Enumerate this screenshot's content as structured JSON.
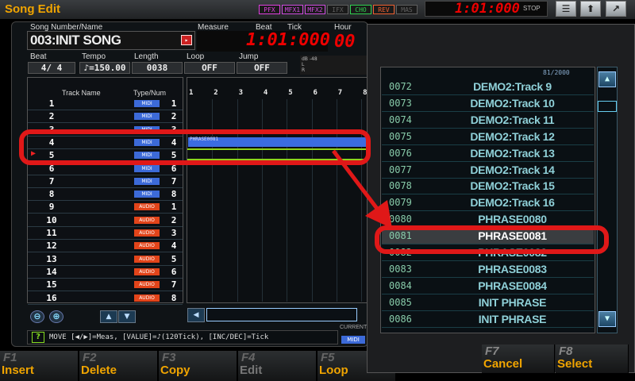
{
  "window": {
    "title": "Song Edit"
  },
  "fx": [
    {
      "label": "PFX",
      "color": "#e040e0"
    },
    {
      "label": "MFX1",
      "color": "#d04ce0"
    },
    {
      "label": "MFX2",
      "color": "#d04ce0"
    },
    {
      "label": "IFX",
      "color": "#606060"
    },
    {
      "label": "CHO",
      "color": "#30d050"
    },
    {
      "label": "REV",
      "color": "#f06030"
    },
    {
      "label": "MAS",
      "color": "#606060"
    }
  ],
  "transport": {
    "time": "1:01:000",
    "status": "STOP"
  },
  "header": {
    "song_label": "Song Number/Name",
    "song_name": "003:INIT SONG",
    "measure_label": "Measure",
    "beat_label": "Beat",
    "tick_label": "Tick",
    "hour_label": "Hour",
    "min_label": "Min",
    "sec_label": "Sec",
    "frame_label": "Frame",
    "position": "1:01:000",
    "hour_value": "00"
  },
  "params": [
    {
      "label": "Beat",
      "value": "4/ 4"
    },
    {
      "label": "Tempo",
      "value": "♪=150.00"
    },
    {
      "label": "Length",
      "value": "0038"
    },
    {
      "label": "Loop",
      "value": "OFF"
    },
    {
      "label": "Jump",
      "value": "OFF"
    }
  ],
  "meter": {
    "db": "dB -48",
    "l": "L",
    "r": "R"
  },
  "tracks": {
    "col_name": "Track Name",
    "col_type": "Type/Num",
    "rows": [
      {
        "num": "1",
        "type": "MIDI",
        "no": "1"
      },
      {
        "num": "2",
        "type": "MIDI",
        "no": "2"
      },
      {
        "num": "3",
        "type": "MIDI",
        "no": "3"
      },
      {
        "num": "4",
        "type": "MIDI",
        "no": "4"
      },
      {
        "num": "5",
        "type": "MIDI",
        "no": "5"
      },
      {
        "num": "6",
        "type": "MIDI",
        "no": "6"
      },
      {
        "num": "7",
        "type": "MIDI",
        "no": "7"
      },
      {
        "num": "8",
        "type": "MIDI",
        "no": "8"
      },
      {
        "num": "9",
        "type": "AUDIO",
        "no": "1"
      },
      {
        "num": "10",
        "type": "AUDIO",
        "no": "2"
      },
      {
        "num": "11",
        "type": "AUDIO",
        "no": "3"
      },
      {
        "num": "12",
        "type": "AUDIO",
        "no": "4"
      },
      {
        "num": "13",
        "type": "AUDIO",
        "no": "5"
      },
      {
        "num": "14",
        "type": "AUDIO",
        "no": "6"
      },
      {
        "num": "15",
        "type": "AUDIO",
        "no": "7"
      },
      {
        "num": "16",
        "type": "AUDIO",
        "no": "8"
      }
    ]
  },
  "timeline": {
    "measures": [
      "1",
      "2",
      "3",
      "4",
      "5",
      "6",
      "7",
      "8"
    ],
    "phrase": "PHRASE0081"
  },
  "current": {
    "label": "CURRENT",
    "badge": "MIDI"
  },
  "hint": "MOVE [◀/▶]=Meas, [VALUE]=♪(120Tick), [INC/DEC]=Tick",
  "function_keys": [
    {
      "key": "F1",
      "label": "Insert"
    },
    {
      "key": "F2",
      "label": "Delete"
    },
    {
      "key": "F3",
      "label": "Copy"
    },
    {
      "key": "F4",
      "label": "Edit"
    },
    {
      "key": "F5",
      "label": "Loop"
    }
  ],
  "popup": {
    "count": "81/2000",
    "rows": [
      {
        "num": "0072",
        "name": "DEMO2:Track 9"
      },
      {
        "num": "0073",
        "name": "DEMO2:Track 10"
      },
      {
        "num": "0074",
        "name": "DEMO2:Track 11"
      },
      {
        "num": "0075",
        "name": "DEMO2:Track 12"
      },
      {
        "num": "0076",
        "name": "DEMO2:Track 13"
      },
      {
        "num": "0077",
        "name": "DEMO2:Track 14"
      },
      {
        "num": "0078",
        "name": "DEMO2:Track 15"
      },
      {
        "num": "0079",
        "name": "DEMO2:Track 16"
      },
      {
        "num": "0080",
        "name": "PHRASE0080"
      },
      {
        "num": "0081",
        "name": "PHRASE0081"
      },
      {
        "num": "0082",
        "name": "PHRASE0082"
      },
      {
        "num": "0083",
        "name": "PHRASE0083"
      },
      {
        "num": "0084",
        "name": "PHRASE0084"
      },
      {
        "num": "0085",
        "name": "INIT PHRASE"
      },
      {
        "num": "0086",
        "name": "INIT PHRASE"
      }
    ],
    "cancel_key": "F7",
    "cancel_label": "Cancel",
    "select_key": "F8",
    "select_label": "Select"
  }
}
